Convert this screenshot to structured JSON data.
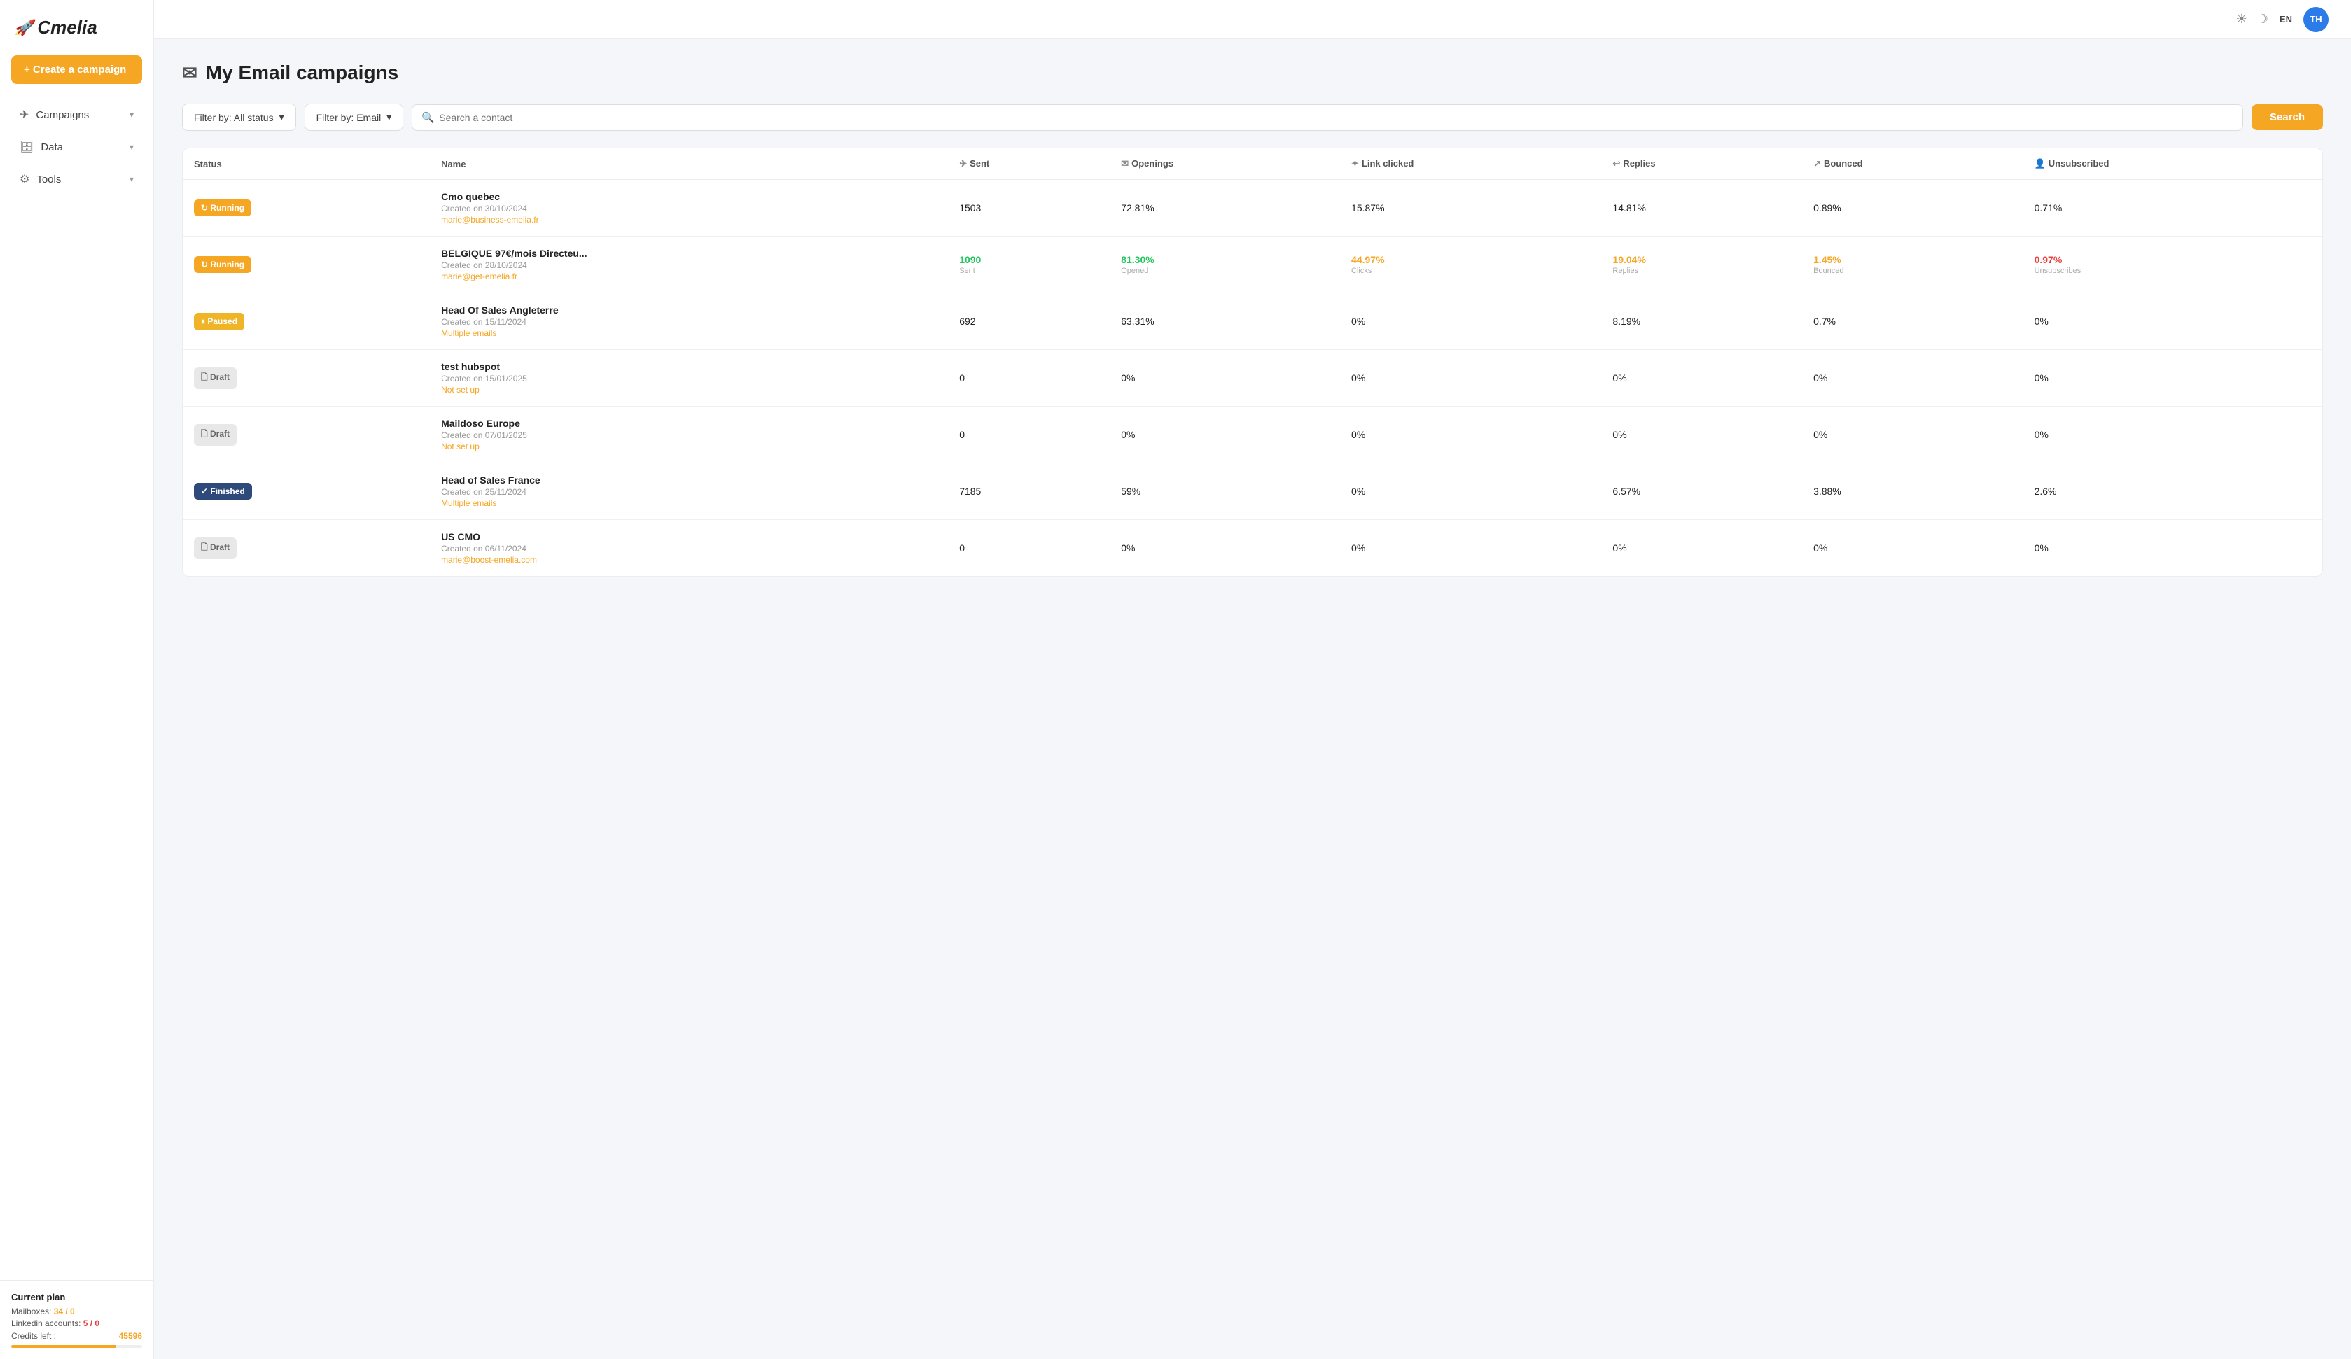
{
  "sidebar": {
    "logo": "Cmelia",
    "logo_icon": "🚀",
    "create_btn": "+ Create a campaign",
    "nav": [
      {
        "id": "campaigns",
        "icon": "✈",
        "label": "Campaigns",
        "chevron": "▾"
      },
      {
        "id": "data",
        "icon": "🗄",
        "label": "Data",
        "chevron": "▾"
      },
      {
        "id": "tools",
        "icon": "⚙",
        "label": "Tools",
        "chevron": "▾"
      }
    ],
    "plan": {
      "title": "Current plan",
      "mailboxes_label": "Mailboxes:",
      "mailboxes_value": "34 / 0",
      "linkedin_label": "Linkedin accounts:",
      "linkedin_value": "5 / 0",
      "credits_label": "Credits left :",
      "credits_value": "45596"
    }
  },
  "topbar": {
    "lang": "EN",
    "avatar": "TH",
    "sun_icon": "☀",
    "moon_icon": "☽"
  },
  "page": {
    "title": "My Email campaigns",
    "title_icon": "✉"
  },
  "filters": {
    "status_label": "Filter by: All status",
    "type_label": "Filter by: Email",
    "search_placeholder": "Search a contact",
    "search_btn": "Search"
  },
  "table": {
    "columns": [
      {
        "id": "status",
        "label": "Status",
        "icon": ""
      },
      {
        "id": "name",
        "label": "Name",
        "icon": ""
      },
      {
        "id": "sent",
        "label": "Sent",
        "icon": "✈"
      },
      {
        "id": "openings",
        "label": "Openings",
        "icon": "✉"
      },
      {
        "id": "link_clicked",
        "label": "Link clicked",
        "icon": "✦"
      },
      {
        "id": "replies",
        "label": "Replies",
        "icon": "↩"
      },
      {
        "id": "bounced",
        "label": "Bounced",
        "icon": "↗"
      },
      {
        "id": "unsubscribed",
        "label": "Unsubscribed",
        "icon": "👤"
      }
    ],
    "rows": [
      {
        "status": "Running",
        "status_type": "running",
        "name": "Cmo quebec",
        "date": "Created on 30/10/2024",
        "email": "marie@business-emelia.fr",
        "email_type": "email",
        "sent": "1503",
        "sent_sub": "",
        "openings": "72.81%",
        "openings_color": "default",
        "link_clicked": "15.87%",
        "link_clicked_color": "default",
        "replies": "14.81%",
        "replies_color": "default",
        "bounced": "0.89%",
        "bounced_color": "default",
        "unsubscribed": "0.71%",
        "unsubscribed_color": "default"
      },
      {
        "status": "Running",
        "status_type": "running",
        "name": "BELGIQUE 97€/mois Directeu...",
        "date": "Created on 28/10/2024",
        "email": "marie@get-emelia.fr",
        "email_type": "email",
        "sent": "1090",
        "sent_sub": "Sent",
        "sent_color": "green",
        "openings": "81.30%",
        "openings_sub": "Opened",
        "openings_color": "green",
        "link_clicked": "44.97%",
        "link_clicked_sub": "Clicks",
        "link_clicked_color": "orange",
        "replies": "19.04%",
        "replies_sub": "Replies",
        "replies_color": "orange",
        "bounced": "1.45%",
        "bounced_sub": "Bounced",
        "bounced_color": "orange",
        "unsubscribed": "0.97%",
        "unsubscribed_sub": "Unsubscribes",
        "unsubscribed_color": "red"
      },
      {
        "status": "Paused",
        "status_type": "paused",
        "name": "Head Of Sales Angleterre",
        "date": "Created on 15/11/2024",
        "email": "Multiple emails",
        "email_type": "multi",
        "sent": "692",
        "sent_sub": "",
        "openings": "63.31%",
        "openings_color": "default",
        "link_clicked": "0%",
        "link_clicked_color": "default",
        "replies": "8.19%",
        "replies_color": "default",
        "bounced": "0.7%",
        "bounced_color": "default",
        "unsubscribed": "0%",
        "unsubscribed_color": "default"
      },
      {
        "status": "Draft",
        "status_type": "draft",
        "name": "test hubspot",
        "date": "Created on 15/01/2025",
        "email": "Not set up",
        "email_type": "notset",
        "sent": "0",
        "openings": "0%",
        "link_clicked": "0%",
        "replies": "0%",
        "bounced": "0%",
        "unsubscribed": "0%"
      },
      {
        "status": "Draft",
        "status_type": "draft",
        "name": "Maildoso Europe",
        "date": "Created on 07/01/2025",
        "email": "Not set up",
        "email_type": "notset",
        "sent": "0",
        "openings": "0%",
        "link_clicked": "0%",
        "replies": "0%",
        "bounced": "0%",
        "unsubscribed": "0%"
      },
      {
        "status": "Finished",
        "status_type": "finished",
        "name": "Head of Sales France",
        "date": "Created on 25/11/2024",
        "email": "Multiple emails",
        "email_type": "multi",
        "sent": "7185",
        "openings": "59%",
        "link_clicked": "0%",
        "replies": "6.57%",
        "bounced": "3.88%",
        "unsubscribed": "2.6%"
      },
      {
        "status": "Draft",
        "status_type": "draft",
        "name": "US CMO",
        "date": "Created on 06/11/2024",
        "email": "marie@boost-emelia.com",
        "email_type": "email",
        "sent": "0",
        "openings": "0%",
        "link_clicked": "0%",
        "replies": "0%",
        "bounced": "0%",
        "unsubscribed": "0%"
      }
    ]
  }
}
